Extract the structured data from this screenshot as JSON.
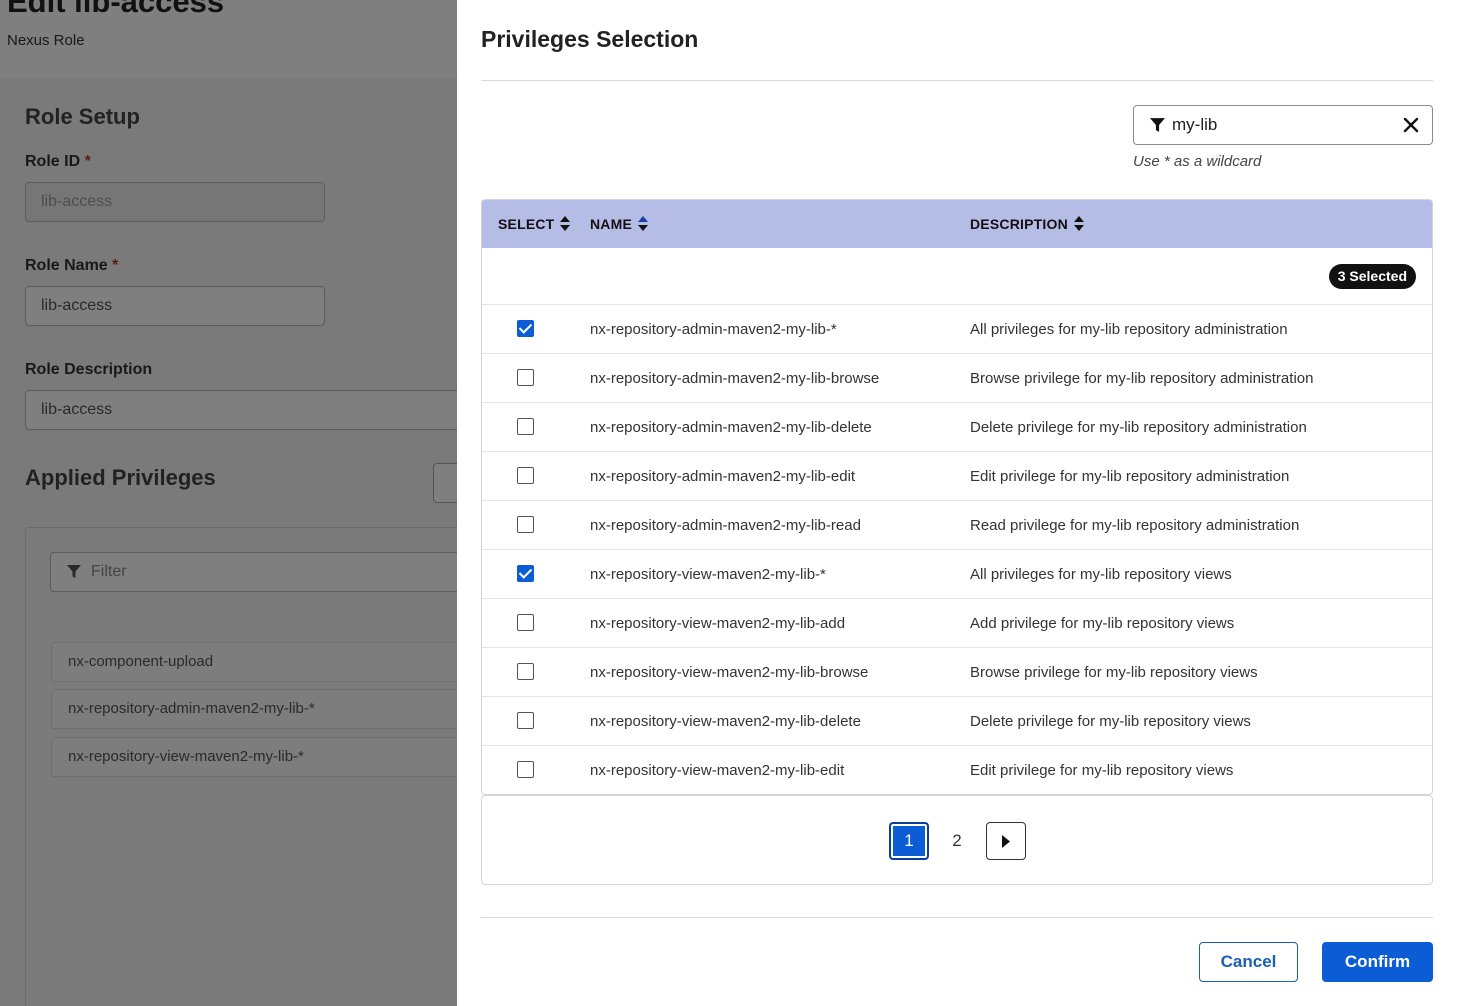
{
  "background": {
    "page_title": "Edit lib-access",
    "page_subtitle": "Nexus Role",
    "role_setup_heading": "Role Setup",
    "role_id_label": "Role ID",
    "role_id_value": "lib-access",
    "role_name_label": "Role Name",
    "role_name_value": "lib-access",
    "role_description_label": "Role Description",
    "role_description_value": "lib-access",
    "required_marker": "*",
    "applied_privileges_heading": "Applied Privileges",
    "applied_filter_placeholder": "Filter",
    "applied_items": [
      "nx-component-upload",
      "nx-repository-admin-maven2-my-lib-*",
      "nx-repository-view-maven2-my-lib-*"
    ]
  },
  "modal": {
    "title": "Privileges Selection",
    "filter": {
      "value": "my-lib",
      "hint": "Use * as a wildcard",
      "icon": "filter-icon",
      "clear_icon": "close-icon"
    },
    "table": {
      "headers": {
        "select": "SELECT",
        "name": "NAME",
        "description": "DESCRIPTION"
      },
      "selected_badge": "3 Selected",
      "rows": [
        {
          "checked": true,
          "name": "nx-repository-admin-maven2-my-lib-*",
          "description": "All privileges for my-lib repository administration"
        },
        {
          "checked": false,
          "name": "nx-repository-admin-maven2-my-lib-browse",
          "description": "Browse privilege for my-lib repository administration"
        },
        {
          "checked": false,
          "name": "nx-repository-admin-maven2-my-lib-delete",
          "description": "Delete privilege for my-lib repository administration"
        },
        {
          "checked": false,
          "name": "nx-repository-admin-maven2-my-lib-edit",
          "description": "Edit privilege for my-lib repository administration"
        },
        {
          "checked": false,
          "name": "nx-repository-admin-maven2-my-lib-read",
          "description": "Read privilege for my-lib repository administration"
        },
        {
          "checked": true,
          "name": "nx-repository-view-maven2-my-lib-*",
          "description": "All privileges for my-lib repository views"
        },
        {
          "checked": false,
          "name": "nx-repository-view-maven2-my-lib-add",
          "description": "Add privilege for my-lib repository views"
        },
        {
          "checked": false,
          "name": "nx-repository-view-maven2-my-lib-browse",
          "description": "Browse privilege for my-lib repository views"
        },
        {
          "checked": false,
          "name": "nx-repository-view-maven2-my-lib-delete",
          "description": "Delete privilege for my-lib repository views"
        },
        {
          "checked": false,
          "name": "nx-repository-view-maven2-my-lib-edit",
          "description": "Edit privilege for my-lib repository views"
        }
      ]
    },
    "pagination": {
      "current_page": "1",
      "other_page": "2",
      "next_icon": "caret-right-icon"
    },
    "buttons": {
      "cancel": "Cancel",
      "confirm": "Confirm"
    }
  },
  "colors": {
    "primary": "#0b5cd5",
    "table_header": "#b5bde6",
    "overlay": "rgba(0,0,0,0.5)",
    "required": "#c0392b"
  }
}
